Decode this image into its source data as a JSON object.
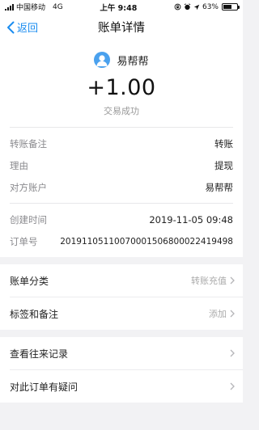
{
  "status_bar": {
    "carrier": "中国移动",
    "network": "4G",
    "time": "上午 9:48",
    "battery": "63%",
    "battery_level": 0.63
  },
  "nav": {
    "back_label": "返回",
    "title": "账单详情"
  },
  "summary": {
    "payee": "易帮帮",
    "amount": "+1.00",
    "status": "交易成功"
  },
  "details": {
    "group1": [
      {
        "label": "转账备注",
        "value": "转账"
      },
      {
        "label": "理由",
        "value": "提现"
      },
      {
        "label": "对方账户",
        "value": "易帮帮"
      }
    ],
    "group2": [
      {
        "label": "创建时间",
        "value": "2019-11-05 09:48"
      },
      {
        "label": "订单号",
        "value": "20191105110070001506800022419498"
      }
    ]
  },
  "menu1": [
    {
      "label": "账单分类",
      "value": "转账充值"
    },
    {
      "label": "标签和备注",
      "value": "添加"
    }
  ],
  "menu2": [
    {
      "label": "查看往来记录"
    },
    {
      "label": "对此订单有疑问"
    }
  ],
  "colors": {
    "accent": "#1a8cf0",
    "avatar": "#4aa1ee",
    "background": "#f2f2f4"
  }
}
